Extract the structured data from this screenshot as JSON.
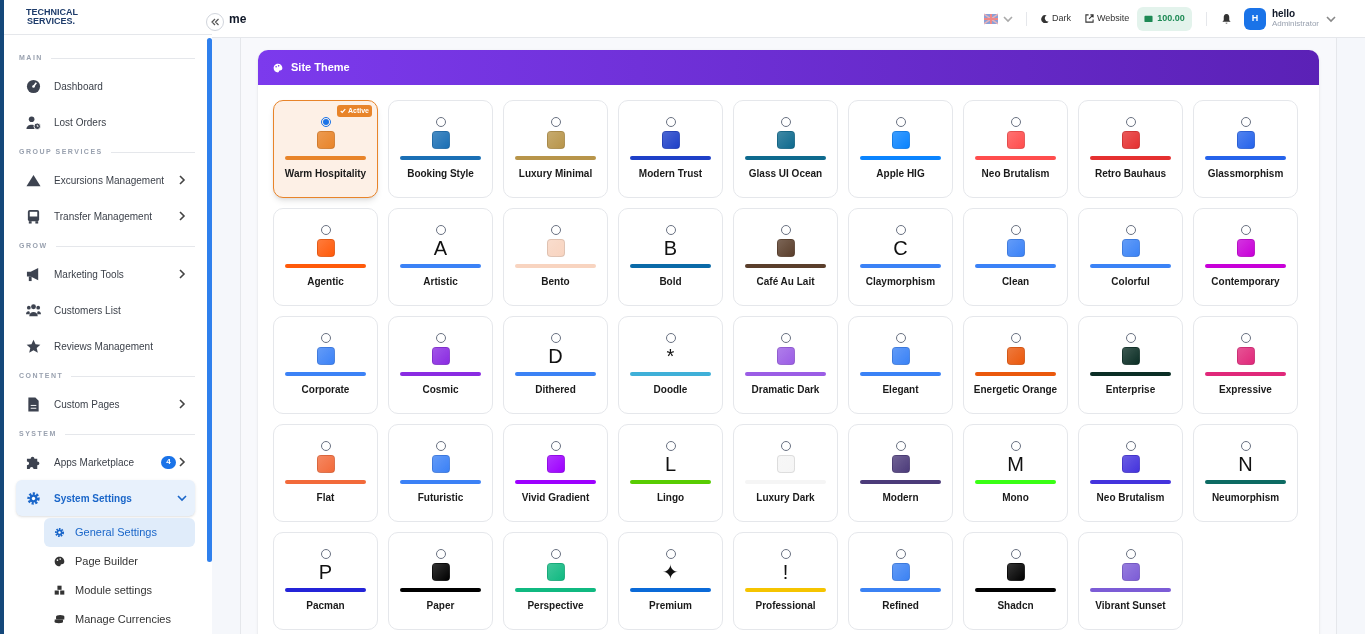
{
  "sidebar": {
    "logo": "TECHNICAL SERVICES.",
    "sections": [
      {
        "title": "MAIN",
        "items": [
          {
            "label": "Dashboard",
            "has_arrow": false,
            "selected": false
          },
          {
            "label": "Lost Orders",
            "has_arrow": false,
            "selected": false
          }
        ]
      },
      {
        "title": "GROUP SERVICES",
        "items": [
          {
            "label": "Excursions Management",
            "has_arrow": true,
            "selected": false
          },
          {
            "label": "Transfer Management",
            "has_arrow": true,
            "selected": false
          }
        ]
      },
      {
        "title": "GROW",
        "items": [
          {
            "label": "Marketing Tools",
            "has_arrow": true,
            "selected": false
          },
          {
            "label": "Customers List",
            "has_arrow": false,
            "selected": false
          },
          {
            "label": "Reviews Management",
            "has_arrow": false,
            "selected": false
          }
        ]
      },
      {
        "title": "CONTENT",
        "items": [
          {
            "label": "Custom Pages",
            "has_arrow": true,
            "selected": false
          }
        ]
      },
      {
        "title": "SYSTEM",
        "items": [
          {
            "label": "Apps Marketplace",
            "has_arrow": true,
            "badge": "4",
            "selected": false
          },
          {
            "label": "System Settings",
            "has_arrow": true,
            "expanded": true,
            "selected": true,
            "children": [
              {
                "label": "General Settings",
                "selected": true
              },
              {
                "label": "Page Builder",
                "selected": false
              },
              {
                "label": "Module settings",
                "selected": false
              },
              {
                "label": "Manage Currencies",
                "selected": false
              }
            ]
          }
        ]
      }
    ]
  },
  "topbar": {
    "title": "me",
    "theme_toggle": "Dark",
    "website_link": "Website",
    "balance": "100.00",
    "user": {
      "initial": "H",
      "name": "hello",
      "role": "Administrator"
    }
  },
  "panel": {
    "title": "Site Theme",
    "active_badge": "Active",
    "themes": [
      {
        "name": "Warm Hospitality",
        "color": "#e8842a",
        "kind": "icon",
        "selected": true
      },
      {
        "name": "Booking Style",
        "color": "#1a6fb5",
        "kind": "icon",
        "selected": false
      },
      {
        "name": "Luxury Minimal",
        "color": "#b8954a",
        "kind": "icon",
        "selected": false
      },
      {
        "name": "Modern Trust",
        "color": "#1e40c8",
        "kind": "icon",
        "selected": false
      },
      {
        "name": "Glass UI Ocean",
        "color": "#0e6a8e",
        "kind": "icon",
        "selected": false
      },
      {
        "name": "Apple HIG",
        "color": "#0a84ff",
        "kind": "icon",
        "selected": false
      },
      {
        "name": "Neo Brutalism",
        "color": "#ff4d4d",
        "kind": "icon",
        "selected": false
      },
      {
        "name": "Retro Bauhaus",
        "color": "#e53030",
        "kind": "icon",
        "selected": false
      },
      {
        "name": "Glassmorphism",
        "color": "#2563eb",
        "kind": "icon",
        "selected": false
      },
      {
        "name": "Agentic",
        "color": "#ff5a0a",
        "kind": "icon",
        "selected": false
      },
      {
        "name": "Artistic",
        "color": "#3b82f6",
        "kind": "letter",
        "glyph": "A",
        "selected": false
      },
      {
        "name": "Bento",
        "color": "#f8d4c0",
        "kind": "icon",
        "selected": false
      },
      {
        "name": "Bold",
        "color": "#0a6aa8",
        "kind": "letter",
        "glyph": "B",
        "selected": false
      },
      {
        "name": "Café Au Lait",
        "color": "#5a3e2b",
        "kind": "icon",
        "selected": false
      },
      {
        "name": "Claymorphism",
        "color": "#3b82f6",
        "kind": "letter",
        "glyph": "C",
        "selected": false
      },
      {
        "name": "Clean",
        "color": "#3b82f7",
        "kind": "icon",
        "selected": false
      },
      {
        "name": "Colorful",
        "color": "#3b83f6",
        "kind": "icon",
        "selected": false
      },
      {
        "name": "Contemporary",
        "color": "#c800d8",
        "kind": "icon",
        "selected": false
      },
      {
        "name": "Corporate",
        "color": "#3c82f6",
        "kind": "icon",
        "selected": false
      },
      {
        "name": "Cosmic",
        "color": "#8a2be2",
        "kind": "icon",
        "selected": false
      },
      {
        "name": "Dithered",
        "color": "#3b82f5",
        "kind": "letter",
        "glyph": "D",
        "selected": false
      },
      {
        "name": "Doodle",
        "color": "#3fb0d8",
        "kind": "letter",
        "glyph": "*",
        "selected": false
      },
      {
        "name": "Dramatic Dark",
        "color": "#9b5de5",
        "kind": "icon",
        "selected": false
      },
      {
        "name": "Elegant",
        "color": "#3a82f6",
        "kind": "icon",
        "selected": false
      },
      {
        "name": "Energetic Orange",
        "color": "#ea580c",
        "kind": "icon",
        "selected": false
      },
      {
        "name": "Enterprise",
        "color": "#0b2e25",
        "kind": "icon",
        "selected": false
      },
      {
        "name": "Expressive",
        "color": "#e0287a",
        "kind": "icon",
        "selected": false
      },
      {
        "name": "Flat",
        "color": "#f26a3a",
        "kind": "icon",
        "selected": false
      },
      {
        "name": "Futuristic",
        "color": "#3b81f6",
        "kind": "icon",
        "selected": false
      },
      {
        "name": "Vivid Gradient",
        "color": "#9d00ff",
        "kind": "icon",
        "selected": false
      },
      {
        "name": "Lingo",
        "color": "#58cc02",
        "kind": "letter",
        "glyph": "L",
        "selected": false
      },
      {
        "name": "Luxury Dark",
        "color": "#f5f5f5",
        "kind": "icon",
        "selected": false
      },
      {
        "name": "Modern",
        "color": "#4c3b7a",
        "kind": "icon",
        "selected": false
      },
      {
        "name": "Mono",
        "color": "#39ff14",
        "kind": "letter",
        "glyph": "M",
        "selected": false
      },
      {
        "name": "Neo Brutalism",
        "color": "#4433dd",
        "kind": "icon",
        "selected": false
      },
      {
        "name": "Neumorphism",
        "color": "#0d6b63",
        "kind": "letter",
        "glyph": "N",
        "selected": false
      },
      {
        "name": "Pacman",
        "color": "#2424d8",
        "kind": "letter",
        "glyph": "P",
        "selected": false
      },
      {
        "name": "Paper",
        "color": "#000000",
        "kind": "icon",
        "selected": false
      },
      {
        "name": "Perspective",
        "color": "#10b981",
        "kind": "icon",
        "selected": false
      },
      {
        "name": "Premium",
        "color": "#0a6ad8",
        "kind": "letter",
        "glyph": "✦",
        "selected": false
      },
      {
        "name": "Professional",
        "color": "#f5c400",
        "kind": "letter",
        "glyph": "!",
        "selected": false
      },
      {
        "name": "Refined",
        "color": "#3b82f4",
        "kind": "icon",
        "selected": false
      },
      {
        "name": "Shadcn",
        "color": "#010101",
        "kind": "icon",
        "selected": false
      },
      {
        "name": "Vibrant Sunset",
        "color": "#7c5cd6",
        "kind": "icon",
        "selected": false
      }
    ]
  }
}
